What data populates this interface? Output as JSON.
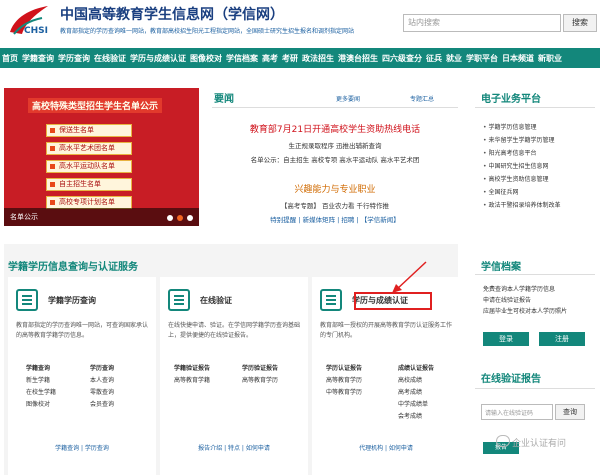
{
  "header": {
    "title": "中国高等教育学生信息网（学信网）",
    "logo_text": "CHSI",
    "sub_links": "教育部指定的学历查询唯一网站，教育部高校招生阳光工程指定网站，全国硕士研究生招生报名和调剂指定网站",
    "search_placeholder": "站内搜索",
    "search_button": "搜索"
  },
  "nav": [
    "首页",
    "学籍查询",
    "学历查询",
    "在线验证",
    "学历与成绩认证",
    "图像校对",
    "学信档案",
    "高考",
    "考研",
    "政法招生",
    "港澳台招生",
    "四六级查分",
    "征兵",
    "就业",
    "学职平台",
    "日本频道",
    "新职业"
  ],
  "banner": {
    "title": "高校特殊类型招生学生名单公示",
    "items": [
      "保送生名单",
      "高水平艺术团名单",
      "高水平运动队名单",
      "自主招生名单",
      "高校专项计划名单"
    ],
    "caption": "名单公示"
  },
  "news": {
    "title": "要闻",
    "more": "更多要闻",
    "topics": "专题汇总",
    "headline": "教育部7月21日开通高校学生资助热线电话",
    "line1": "生正规录取程序 迅推出辅新查询",
    "line2": "名单公示：自主招生 高校专项 高水平运动队 高水平艺术团",
    "headline2": "兴趣能力与专业职业",
    "line3": "【高考专题】 百业农力看  千行特作推",
    "line4": "特别提醒 | 新媒体矩阵 | 招聘 | 【学信新闻】"
  },
  "eservice": {
    "title": "电子业务平台",
    "items": [
      "学籍学历信息管理",
      "来华留学生学籍学历管理",
      "阳光高考信息平台",
      "中国研究生招生信息网",
      "高校学生资助信息管理",
      "全国征兵网",
      "政法干警招录培养体制改革"
    ]
  },
  "services": {
    "title": "学籍学历信息查询与认证服务",
    "cards": [
      {
        "name": "学籍学历查询",
        "desc": "教育部指定的学历查询唯一网站，可查询国家承认的高等教育学籍学历信息。",
        "col1": [
          "学籍查询",
          "新生学籍",
          "在校生学籍",
          "图像校对"
        ],
        "col2": [
          "学历查询",
          "本人查询",
          "零散查询",
          "会员查询"
        ],
        "foot": "学籍查询 | 学历查询"
      },
      {
        "name": "在线验证",
        "desc": "在线快捷申请、验证。在学信网学籍学历查询基础上，提供便捷的在线验证报告。",
        "col1": [
          "学籍验证报告",
          "高等教育学籍"
        ],
        "col2": [
          "学历验证报告",
          "高等教育学历"
        ],
        "foot": "报告介绍 | 特点 | 如何申请"
      },
      {
        "name": "学历与成绩认证",
        "desc": "教育部唯一授权的开展高等教育学历认证服务工作的专门机构。",
        "col1": [
          "学历认证报告",
          "高等教育学历",
          "中等教育学历"
        ],
        "col2": [
          "成绩认证报告",
          "高校成绩",
          "高考成绩",
          "中学成绩单",
          "会考成绩"
        ],
        "foot": "代理机构 | 如何申请"
      }
    ]
  },
  "archive": {
    "title": "学信档案",
    "items": [
      "免费查询本人学籍学历信息",
      "申请在线验证报告",
      "应届毕业生可校对本人学历照片"
    ],
    "login": "登录",
    "register": "注册"
  },
  "verify": {
    "title": "在线验证报告",
    "placeholder": "请输入在线验证码",
    "button": "查询",
    "foot": "报告"
  },
  "watermark": "企业认证有问"
}
